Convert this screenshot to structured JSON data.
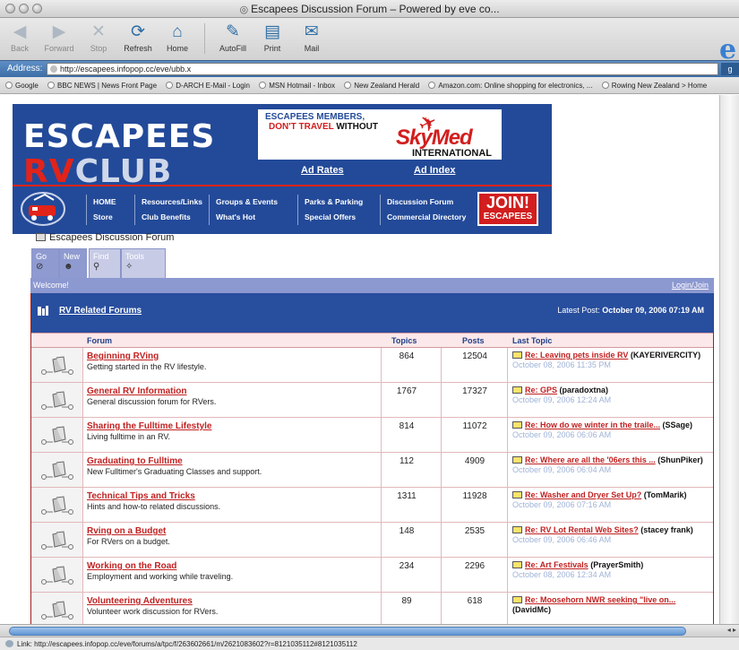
{
  "window": {
    "title": "Escapees Discussion Forum – Powered by eve co..."
  },
  "toolbar": {
    "buttons": [
      {
        "label": "Back",
        "icon": "back-arrow-icon"
      },
      {
        "label": "Forward",
        "icon": "forward-arrow-icon"
      },
      {
        "label": "Stop",
        "icon": "stop-x-icon"
      },
      {
        "label": "Refresh",
        "icon": "refresh-icon"
      },
      {
        "label": "Home",
        "icon": "home-icon"
      },
      {
        "label": "AutoFill",
        "icon": "autofill-icon"
      },
      {
        "label": "Print",
        "icon": "printer-icon"
      },
      {
        "label": "Mail",
        "icon": "mail-icon"
      }
    ]
  },
  "address": {
    "label": "Address:",
    "url": "http://escapees.infopop.cc/eve/ubb.x",
    "go": "g"
  },
  "favorites": [
    "Google",
    "BBC NEWS | News Front Page",
    "D-ARCH E-Mail - Login",
    "MSN Hotmail - Inbox",
    "New Zealand Herald",
    "Amazon.com: Online shopping for electronics, ...",
    "Rowing New Zealand > Home"
  ],
  "banner": {
    "logo_top": "ESCAPEES",
    "logo_rv": "RV",
    "logo_club": "CLUB",
    "ad_line1": "ESCAPEES MEMBERS,",
    "ad_line2_a": "DON'T TRAVEL",
    "ad_line2_b": "WITHOUT",
    "ad_brand": "SkyMed",
    "ad_brand_sub": "INTERNATIONAL",
    "ad_rates": "Ad Rates",
    "ad_index": "Ad Index",
    "nav_col1": [
      "HOME",
      "Store"
    ],
    "nav_col2": [
      "Resources/Links",
      "Club Benefits"
    ],
    "nav_col3": [
      "Groups & Events",
      "What's Hot"
    ],
    "nav_col4": [
      "Parks & Parking",
      "Special Offers"
    ],
    "nav_col5": [
      "Discussion Forum",
      "Commercial Directory"
    ],
    "join_1": "JOIN!",
    "join_2": "ESCAPEES",
    "accent_red": "#e2231a",
    "accent_blue": "#234a99"
  },
  "crumb": "Escapees Discussion Forum",
  "tabs": [
    {
      "label": "Go",
      "icon": "go-icon"
    },
    {
      "label": "New",
      "icon": "new-icon"
    },
    {
      "label": "Find",
      "icon": "find-icon"
    },
    {
      "label": "Tools",
      "icon": "tools-icon"
    }
  ],
  "welcome": {
    "text": "Welcome!",
    "login": "Login/Join"
  },
  "category": {
    "name": "RV Related Forums",
    "latest_label": "Latest Post:",
    "latest_value": "October 09, 2006 07:19 AM"
  },
  "headers": {
    "forum": "Forum",
    "topics": "Topics",
    "posts": "Posts",
    "last": "Last Topic"
  },
  "forums": [
    {
      "name": "Beginning RVing",
      "desc": "Getting started in the RV lifestyle.",
      "topics": "864",
      "posts": "12504",
      "last_title": "Re: Leaving pets inside RV",
      "last_user": "(KAYERIVERCITY)",
      "last_date": "October 08, 2006 11:35 PM"
    },
    {
      "name": "General RV Information",
      "desc": "General discussion forum for RVers.",
      "topics": "1767",
      "posts": "17327",
      "last_title": "Re: GPS",
      "last_user": "(paradoxtna)",
      "last_date": "October 09, 2006 12:24 AM"
    },
    {
      "name": "Sharing the Fulltime Lifestyle",
      "desc": "Living fulltime in an RV.",
      "topics": "814",
      "posts": "11072",
      "last_title": "Re: How do we winter in the traile...",
      "last_user": "(SSage)",
      "last_date": "October 09, 2006 06:06 AM"
    },
    {
      "name": "Graduating to Fulltime",
      "desc": "New Fulltimer's Graduating Classes and support.",
      "topics": "112",
      "posts": "4909",
      "last_title": "Re: Where are all the '06ers this ...",
      "last_user": "(ShunPiker)",
      "last_date": "October 09, 2006 06:04 AM"
    },
    {
      "name": "Technical Tips and Tricks",
      "desc": "Hints and how-to related discussions.",
      "topics": "1311",
      "posts": "11928",
      "last_title": "Re: Washer and Dryer Set Up?",
      "last_user": "(TomMarik)",
      "last_date": "October 09, 2006 07:16 AM"
    },
    {
      "name": "Rving on a Budget",
      "desc": "For RVers on a budget.",
      "topics": "148",
      "posts": "2535",
      "last_title": "Re: RV Lot Rental Web Sites?",
      "last_user": "(stacey frank)",
      "last_date": "October 09, 2006 06:46 AM"
    },
    {
      "name": "Working on the Road",
      "desc": "Employment and working while traveling.",
      "topics": "234",
      "posts": "2296",
      "last_title": "Re: Art Festivals",
      "last_user": "(PrayerSmith)",
      "last_date": "October 08, 2006 12:34 AM"
    },
    {
      "name": "Volunteering Adventures",
      "desc": "Volunteer work discussion for RVers.",
      "topics": "89",
      "posts": "618",
      "last_title": "Re: Moosehorn NWR seeking \"live on...",
      "last_user": "(DavidMc)",
      "last_date": ""
    }
  ],
  "status": "Link: http://escapees.infopop.cc/eve/forums/a/tpc/f/263602661/m/2621083602?r=8121035112#8121035112"
}
